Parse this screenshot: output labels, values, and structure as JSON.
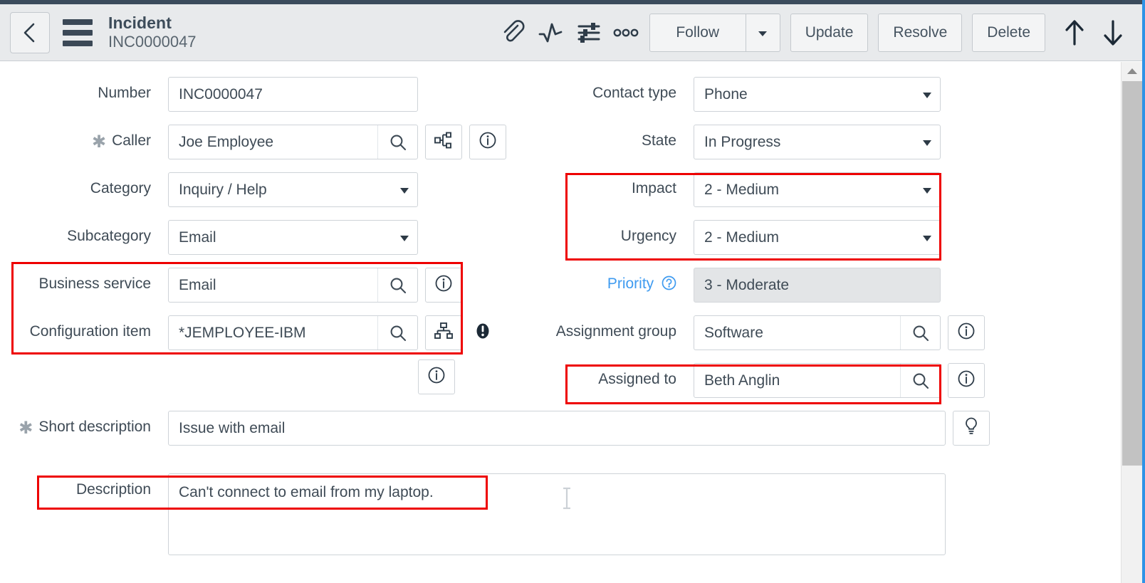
{
  "window": {
    "accent_blue": "#2e93e6",
    "header_bg": "#e8eaec",
    "annotation_color": "#ee0000"
  },
  "header": {
    "back_icon": "chevron-left-icon",
    "menu_icon": "hamburger-menu-icon",
    "title": "Incident",
    "subtitle": "INC0000047",
    "icons": [
      {
        "name": "attachment-icon",
        "label": "Attachments"
      },
      {
        "name": "activity-icon",
        "label": "Activity stream"
      },
      {
        "name": "form-settings-icon",
        "label": "Personalize form"
      },
      {
        "name": "more-options-icon",
        "label": "More options"
      }
    ],
    "follow_label": "Follow",
    "follow_caret_icon": "chevron-down-icon",
    "update_label": "Update",
    "resolve_label": "Resolve",
    "delete_label": "Delete",
    "prev_record_icon": "arrow-up-icon",
    "next_record_icon": "arrow-down-icon"
  },
  "form": {
    "left": {
      "number": {
        "label": "Number",
        "value": "INC0000047"
      },
      "caller": {
        "label": "Caller",
        "value": "Joe Employee",
        "required": true,
        "lookup_icon": "magnifier-icon",
        "extra_icons": [
          "org-chart-icon",
          "info-icon"
        ]
      },
      "category": {
        "label": "Category",
        "value": "Inquiry / Help"
      },
      "subcategory": {
        "label": "Subcategory",
        "value": "Email"
      },
      "business_service": {
        "label": "Business service",
        "value": "Email",
        "lookup_icon": "magnifier-icon",
        "extra_icons": [
          "info-icon"
        ],
        "highlighted": true
      },
      "configuration_item": {
        "label": "Configuration item",
        "value": "*JEMPLOYEE-IBM",
        "lookup_icon": "magnifier-icon",
        "extra_icons": [
          "sitemap-icon",
          "alert-icon",
          "info-icon"
        ],
        "highlighted": true
      },
      "short_description": {
        "label": "Short description",
        "value": "Issue with email",
        "required": true,
        "extra_icons": [
          "lightbulb-icon"
        ]
      },
      "description": {
        "label": "Description",
        "value": "Can't connect to email from my laptop.",
        "highlighted": true
      }
    },
    "right": {
      "contact_type": {
        "label": "Contact type",
        "value": "Phone"
      },
      "state": {
        "label": "State",
        "value": "In Progress"
      },
      "impact": {
        "label": "Impact",
        "value": "2 - Medium",
        "highlighted": true
      },
      "urgency": {
        "label": "Urgency",
        "value": "2 - Medium",
        "highlighted": true
      },
      "priority": {
        "label": "Priority",
        "value": "3 - Moderate",
        "readonly": true,
        "help_icon": "question-circle-icon",
        "label_color": "#3f9bf0"
      },
      "assignment_group": {
        "label": "Assignment group",
        "value": "Software",
        "lookup_icon": "magnifier-icon",
        "extra_icons": [
          "info-icon"
        ]
      },
      "assigned_to": {
        "label": "Assigned to",
        "value": "Beth Anglin",
        "lookup_icon": "magnifier-icon",
        "extra_icons": [
          "info-icon"
        ],
        "highlighted": true
      }
    }
  },
  "scrollbar": {
    "up_arrow_icon": "scroll-up-arrow-icon",
    "thumb": "scroll-thumb"
  }
}
